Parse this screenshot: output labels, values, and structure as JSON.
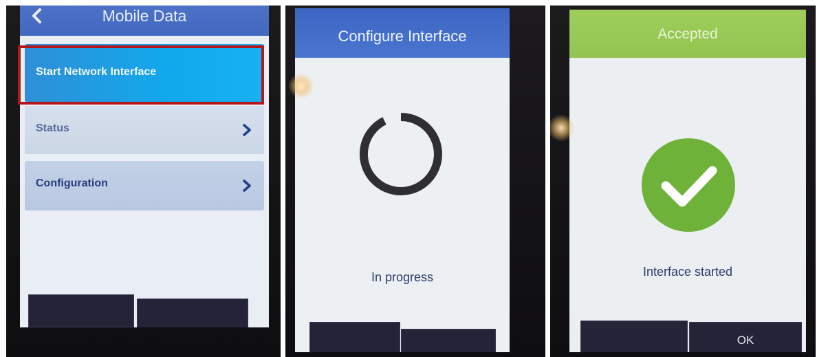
{
  "screen1": {
    "title": "Mobile Data",
    "menu": [
      {
        "label": "Start Network Interface"
      },
      {
        "label": "Status"
      },
      {
        "label": "Configuration"
      }
    ],
    "colors": {
      "header": "#4169bf",
      "selected": "#12a8ec",
      "highlight_box": "#b5161c"
    }
  },
  "screen2": {
    "title": "Configure Interface",
    "status": "In progress",
    "colors": {
      "header": "#3d66c4",
      "spinner": "#2e2e33"
    }
  },
  "screen3": {
    "title": "Accepted",
    "status": "Interface started",
    "softkey_right": "OK",
    "icon": "check-circle-icon",
    "colors": {
      "header": "#93c44f",
      "check": "#6fb23a"
    }
  }
}
